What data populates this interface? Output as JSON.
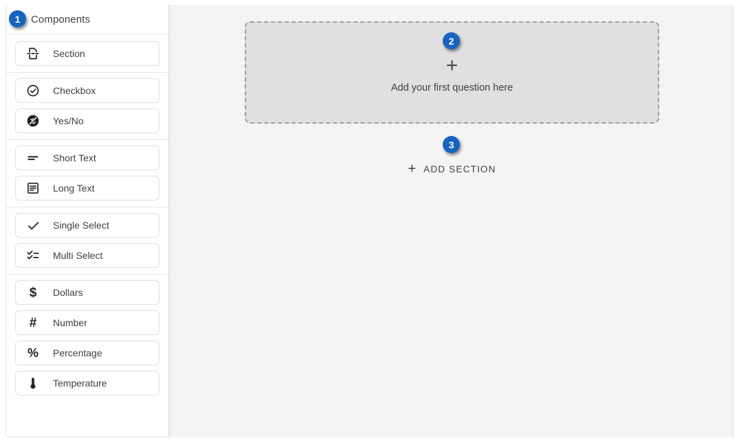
{
  "sidebar": {
    "title": "Components",
    "groups": [
      {
        "name": "structure",
        "items": [
          {
            "label": "Section",
            "icon": "section-split-icon"
          }
        ]
      },
      {
        "name": "boolean",
        "items": [
          {
            "label": "Checkbox",
            "icon": "check-circle-icon"
          },
          {
            "label": "Yes/No",
            "icon": "yes-no-circle-icon"
          }
        ]
      },
      {
        "name": "text",
        "items": [
          {
            "label": "Short Text",
            "icon": "short-text-icon"
          },
          {
            "label": "Long Text",
            "icon": "long-text-icon"
          }
        ]
      },
      {
        "name": "select",
        "items": [
          {
            "label": "Single Select",
            "icon": "check-icon"
          },
          {
            "label": "Multi Select",
            "icon": "checklist-icon"
          }
        ]
      },
      {
        "name": "numeric",
        "items": [
          {
            "label": "Dollars",
            "icon": "dollar-icon"
          },
          {
            "label": "Number",
            "icon": "hash-icon"
          },
          {
            "label": "Percentage",
            "icon": "percent-icon"
          },
          {
            "label": "Temperature",
            "icon": "thermometer-icon"
          }
        ]
      }
    ]
  },
  "canvas": {
    "dropzone": {
      "plus": "+",
      "text": "Add your first question here"
    },
    "add_section": {
      "plus": "+",
      "label": "ADD SECTION"
    }
  },
  "badges": [
    {
      "id": "badge1",
      "label": "1"
    },
    {
      "id": "badge2",
      "label": "2"
    },
    {
      "id": "badge3",
      "label": "3"
    }
  ],
  "colors": {
    "badge_blue": "#1565c0",
    "canvas_bg": "#f4f4f4",
    "dropzone_fill": "#e0e0e0",
    "dropzone_border": "#9e9e9e",
    "panel_border": "#e3e3e3",
    "text_primary": "#3c4043"
  }
}
